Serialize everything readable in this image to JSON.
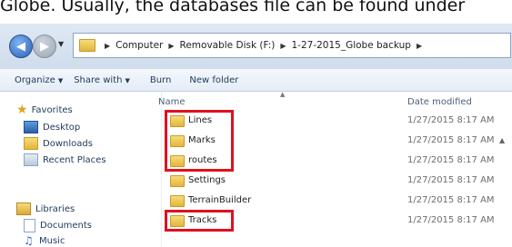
{
  "caption": "Globe. Usually, the databases file can be found under",
  "nav": {
    "path": [
      "Computer",
      "Removable Disk (F:)",
      "1-27-2015_Globe backup"
    ]
  },
  "toolbar": {
    "organize": "Organize",
    "share": "Share with",
    "burn": "Burn",
    "new_folder": "New folder"
  },
  "sidebar": {
    "favorites": "Favorites",
    "desktop": "Desktop",
    "downloads": "Downloads",
    "recent": "Recent Places",
    "libraries": "Libraries",
    "documents": "Documents",
    "music": "Music"
  },
  "columns": {
    "name": "Name",
    "date": "Date modified"
  },
  "files": [
    {
      "name": "Lines",
      "date": "1/27/2015 8:17 AM",
      "highlighted": true
    },
    {
      "name": "Marks",
      "date": "1/27/2015 8:17 AM",
      "highlighted": true
    },
    {
      "name": "routes",
      "date": "1/27/2015 8:17 AM",
      "highlighted": true
    },
    {
      "name": "Settings",
      "date": "1/27/2015 8:17 AM",
      "highlighted": false
    },
    {
      "name": "TerrainBuilder",
      "date": "1/27/2015 8:17 AM",
      "highlighted": false
    },
    {
      "name": "Tracks",
      "date": "1/27/2015 8:17 AM",
      "highlighted": true
    }
  ],
  "highlight_color": "#e0101f"
}
